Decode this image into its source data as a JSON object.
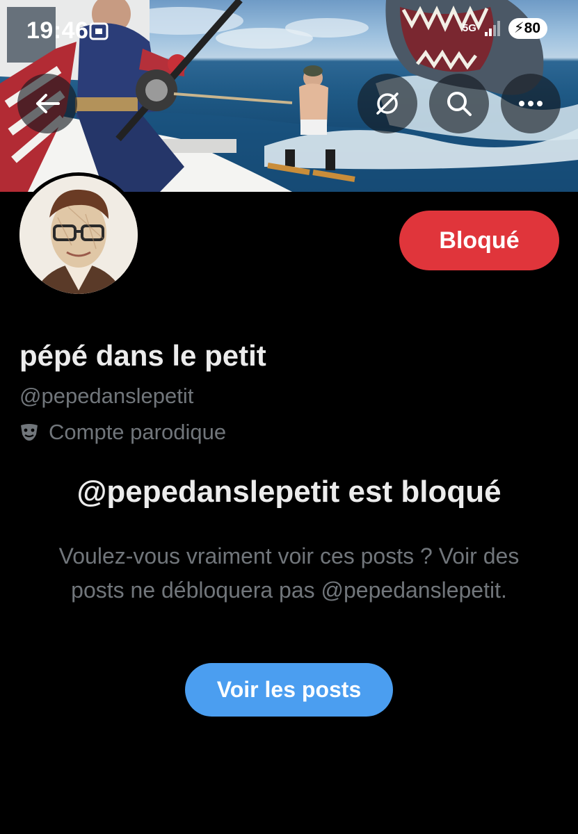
{
  "status_bar": {
    "time": "19:46",
    "network": "5G",
    "battery": "80",
    "icons": [
      "screen-record-icon",
      "signal-icon",
      "battery-charging-icon"
    ]
  },
  "header": {
    "buttons": [
      {
        "name": "back-button",
        "icon": "back-arrow-icon"
      },
      {
        "name": "grok-button",
        "icon": "grok-icon"
      },
      {
        "name": "search-button",
        "icon": "search-icon"
      },
      {
        "name": "more-button",
        "icon": "more-icon"
      }
    ]
  },
  "profile": {
    "display_name": "pépé dans le petit",
    "handle": "@pepedanslepetit",
    "parody_label": "Compte parodique",
    "parody_icon": "theater-mask-icon",
    "blocked_button": "Bloqué"
  },
  "blocked_notice": {
    "title": "@pepedanslepetit est bloqué",
    "description": "Voulez-vous vraiment voir ces posts ? Voir des posts ne débloquera pas @pepedanslepetit.",
    "view_button": "Voir les posts"
  },
  "colors": {
    "background": "#000000",
    "blocked_button": "#e0353b",
    "primary_button": "#4b9ef0",
    "secondary_text": "#71767b",
    "primary_text": "#ececec"
  }
}
